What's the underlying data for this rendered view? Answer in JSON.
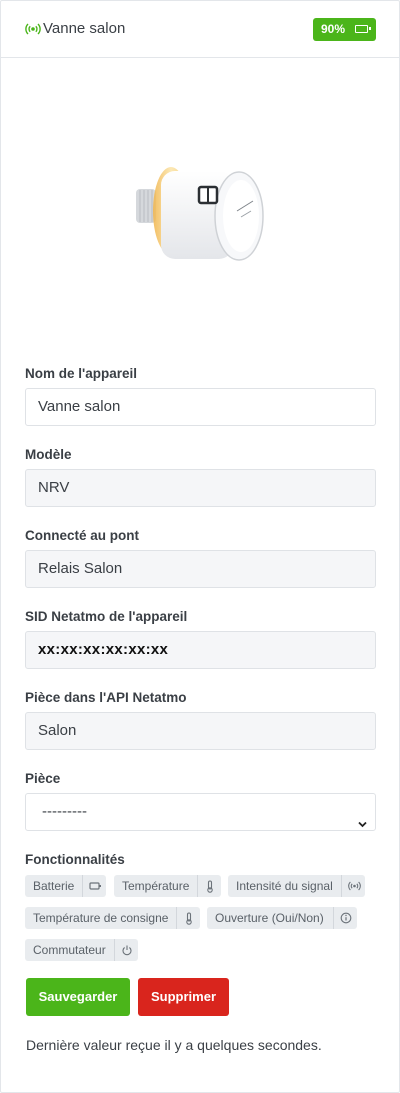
{
  "header": {
    "title": "Vanne salon",
    "battery": "90%",
    "battery_level_percent": 90,
    "accent_color": "#4bb51a"
  },
  "device_image": {
    "icon": "thermostatic-valve-image"
  },
  "fields": [
    {
      "label": "Nom de l'appareil",
      "value": "Vanne salon"
    },
    {
      "label": "Modèle",
      "value": "NRV"
    },
    {
      "label": "Connecté au pont",
      "value": "Relais Salon"
    },
    {
      "label": "SID Netatmo de l'appareil",
      "value": "xx:xx:xx:xx:xx:xx"
    },
    {
      "label": "Pièce dans l'API Netatmo",
      "value": "Salon"
    },
    {
      "label": "Pièce",
      "value": "---------"
    }
  ],
  "features": {
    "label": "Fonctionnalités",
    "items": [
      {
        "label": "Batterie",
        "icon": "battery-icon"
      },
      {
        "label": "Température",
        "icon": "thermometer-icon"
      },
      {
        "label": "Intensité du signal",
        "icon": "signal-icon"
      },
      {
        "label": "Température de consigne",
        "icon": "thermometer-icon"
      },
      {
        "label": "Ouverture (Oui/Non)",
        "icon": "info-icon"
      },
      {
        "label": "Commutateur",
        "icon": "power-icon"
      }
    ]
  },
  "actions": {
    "save": "Sauvegarder",
    "delete": "Supprimer",
    "save_color": "#4bb51a",
    "delete_color": "#d9251d"
  },
  "footer": {
    "last_value": "Dernière valeur reçue il y a quelques secondes."
  }
}
